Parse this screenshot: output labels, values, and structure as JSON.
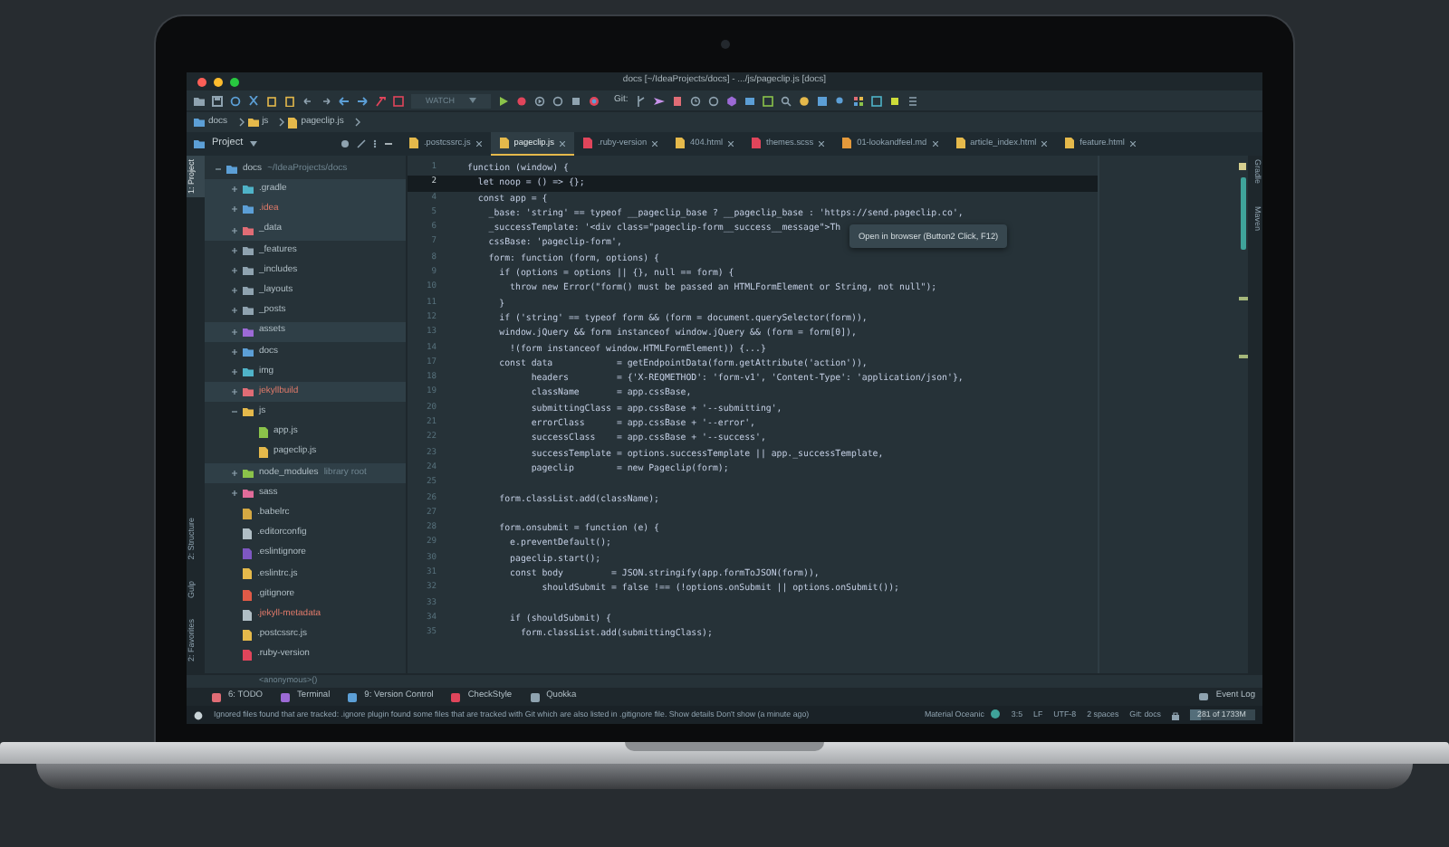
{
  "window": {
    "title": "docs [~/IdeaProjects/docs] - .../js/pageclip.js [docs]"
  },
  "toolbar": {
    "run_config": "WATCH",
    "vcs_label": "Git:"
  },
  "breadcrumb": [
    "docs",
    "js",
    "pageclip.js"
  ],
  "project_panel": {
    "title": "Project"
  },
  "tabs": [
    {
      "label": ".postcssrc.js",
      "color": "#e5b94b",
      "selected": false
    },
    {
      "label": "pageclip.js",
      "color": "#e5b94b",
      "selected": true
    },
    {
      "label": ".ruby-version",
      "color": "#e0455b",
      "selected": false
    },
    {
      "label": "404.html",
      "color": "#e5b94b",
      "selected": false
    },
    {
      "label": "themes.scss",
      "color": "#e0455b",
      "selected": false
    },
    {
      "label": "01-lookandfeel.md",
      "color": "#e59a3b",
      "selected": false
    },
    {
      "label": "article_index.html",
      "color": "#e5b94b",
      "selected": false
    },
    {
      "label": "feature.html",
      "color": "#e5b94b",
      "selected": false
    }
  ],
  "left_strip": {
    "top": [
      {
        "label": "1: Project",
        "selected": true
      }
    ],
    "bottom": [
      {
        "label": "2: Structure",
        "selected": false
      },
      {
        "label": "Gulp",
        "selected": false
      },
      {
        "label": "2: Favorites",
        "selected": false
      }
    ]
  },
  "right_strip": [
    {
      "label": "Gradle"
    },
    {
      "label": "Maven"
    }
  ],
  "tree": [
    {
      "name": "docs",
      "note": "~/IdeaProjects/docs",
      "kind": "folder",
      "color": "#5c9fd6",
      "expanded": true,
      "highlighted": false,
      "ignored": false,
      "children": [
        {
          "name": ".gradle",
          "kind": "folder",
          "color": "#4fb3c8",
          "expanded": false,
          "highlighted": true,
          "ignored": false
        },
        {
          "name": ".idea",
          "kind": "folder",
          "color": "#5c9fd6",
          "expanded": false,
          "highlighted": true,
          "ignored": true
        },
        {
          "name": "_data",
          "kind": "folder",
          "color": "#e06c75",
          "expanded": false,
          "highlighted": true,
          "ignored": false
        },
        {
          "name": "_features",
          "kind": "folder",
          "color": "#8fa3b0",
          "expanded": false,
          "highlighted": false,
          "ignored": false
        },
        {
          "name": "_includes",
          "kind": "folder",
          "color": "#8fa3b0",
          "expanded": false,
          "highlighted": false,
          "ignored": false
        },
        {
          "name": "_layouts",
          "kind": "folder",
          "color": "#8fa3b0",
          "expanded": false,
          "highlighted": false,
          "ignored": false
        },
        {
          "name": "_posts",
          "kind": "folder",
          "color": "#8fa3b0",
          "expanded": false,
          "highlighted": false,
          "ignored": false
        },
        {
          "name": "assets",
          "kind": "folder",
          "color": "#9c6ad6",
          "expanded": false,
          "highlighted": true,
          "ignored": false
        },
        {
          "name": "docs",
          "kind": "folder",
          "color": "#5c9fd6",
          "expanded": false,
          "highlighted": false,
          "ignored": false
        },
        {
          "name": "img",
          "kind": "folder",
          "color": "#4fb3c8",
          "expanded": false,
          "highlighted": false,
          "ignored": false
        },
        {
          "name": "jekyllbuild",
          "kind": "folder",
          "color": "#e06c75",
          "expanded": false,
          "highlighted": true,
          "ignored": true
        },
        {
          "name": "js",
          "kind": "folder",
          "color": "#e5b94b",
          "expanded": true,
          "highlighted": false,
          "ignored": false,
          "children": [
            {
              "name": "app.js",
              "kind": "file",
              "color": "#8bc34a",
              "highlighted": false,
              "ignored": false
            },
            {
              "name": "pageclip.js",
              "kind": "file",
              "color": "#e5b94b",
              "highlighted": false,
              "ignored": false
            }
          ]
        },
        {
          "name": "node_modules",
          "note": "library root",
          "kind": "folder",
          "color": "#8bc34a",
          "expanded": false,
          "highlighted": true,
          "ignored": false
        },
        {
          "name": "sass",
          "kind": "folder",
          "color": "#e06c9a",
          "expanded": false,
          "highlighted": false,
          "ignored": false
        },
        {
          "name": ".babelrc",
          "kind": "file",
          "color": "#d4a843",
          "highlighted": false,
          "ignored": false
        },
        {
          "name": ".editorconfig",
          "kind": "file",
          "color": "#b0bec5",
          "highlighted": false,
          "ignored": false
        },
        {
          "name": ".eslintignore",
          "kind": "file",
          "color": "#7e57c2",
          "highlighted": false,
          "ignored": false
        },
        {
          "name": ".eslintrc.js",
          "kind": "file",
          "color": "#e5b94b",
          "highlighted": false,
          "ignored": false
        },
        {
          "name": ".gitignore",
          "kind": "file",
          "color": "#e05a47",
          "highlighted": false,
          "ignored": false
        },
        {
          "name": ".jekyll-metadata",
          "kind": "file",
          "color": "#b0bec5",
          "highlighted": false,
          "ignored": true
        },
        {
          "name": ".postcssrc.js",
          "kind": "file",
          "color": "#e5b94b",
          "highlighted": false,
          "ignored": false
        },
        {
          "name": ".ruby-version",
          "kind": "file",
          "color": "#e0455b",
          "highlighted": false,
          "ignored": false
        }
      ]
    }
  ],
  "editor": {
    "lines": [
      {
        "number": "1",
        "text": "function (window) {",
        "current": false
      },
      {
        "number": "2",
        "text": "  let noop = () => {};",
        "current": true
      },
      {
        "number": "4",
        "text": "  const app = {",
        "current": false
      },
      {
        "number": "5",
        "text": "    _base: 'string' == typeof __pageclip_base ? __pageclip_base : 'https://send.pageclip.co',",
        "current": false
      },
      {
        "number": "6",
        "text": "    _successTemplate: '<div class=\"pageclip-form__success__message\">Th",
        "current": false
      },
      {
        "number": "7",
        "text": "    cssBase: 'pageclip-form',",
        "current": false
      },
      {
        "number": "8",
        "text": "    form: function (form, options) {",
        "current": false
      },
      {
        "number": "9",
        "text": "      if (options = options || {}, null == form) {",
        "current": false
      },
      {
        "number": "10",
        "text": "        throw new Error(\"form() must be passed an HTMLFormElement or String, not null\");",
        "current": false
      },
      {
        "number": "11",
        "text": "      }",
        "current": false
      },
      {
        "number": "12",
        "text": "      if ('string' == typeof form && (form = document.querySelector(form)),",
        "current": false
      },
      {
        "number": "13",
        "text": "      window.jQuery && form instanceof window.jQuery && (form = form[0]),",
        "current": false
      },
      {
        "number": "14",
        "text": "        !(form instanceof window.HTMLFormElement)) {...}",
        "current": false
      },
      {
        "number": "17",
        "text": "      const data            = getEndpointData(form.getAttribute('action')),",
        "current": false
      },
      {
        "number": "18",
        "text": "            headers         = {'X-REQMETHOD': 'form-v1', 'Content-Type': 'application/json'},",
        "current": false
      },
      {
        "number": "19",
        "text": "            className       = app.cssBase,",
        "current": false
      },
      {
        "number": "20",
        "text": "            submittingClass = app.cssBase + '--submitting',",
        "current": false
      },
      {
        "number": "21",
        "text": "            errorClass      = app.cssBase + '--error',",
        "current": false
      },
      {
        "number": "22",
        "text": "            successClass    = app.cssBase + '--success',",
        "current": false
      },
      {
        "number": "23",
        "text": "            successTemplate = options.successTemplate || app._successTemplate,",
        "current": false
      },
      {
        "number": "24",
        "text": "            pageclip        = new Pageclip(form);",
        "current": false
      },
      {
        "number": "25",
        "current": false
      },
      {
        "number": "26",
        "text": "      form.classList.add(className);",
        "current": false
      },
      {
        "number": "27",
        "current": false
      },
      {
        "number": "28",
        "text": "      form.onsubmit = function (e) {",
        "current": false
      },
      {
        "number": "29",
        "text": "        e.preventDefault();",
        "current": false
      },
      {
        "number": "30",
        "text": "        pageclip.start();",
        "current": false
      },
      {
        "number": "31",
        "text": "        const body         = JSON.stringify(app.formToJSON(form)),",
        "current": false
      },
      {
        "number": "32",
        "text": "              shouldSubmit = false !== (!options.onSubmit || options.onSubmit());",
        "current": false
      },
      {
        "number": "33",
        "current": false
      },
      {
        "number": "34",
        "text": "        if (shouldSubmit) {",
        "current": false
      },
      {
        "number": "35",
        "text": "          form.classList.add(submittingClass);",
        "current": false
      }
    ],
    "tooltip": "Open in browser (Button2 Click, F12)",
    "breadcrumb": "<anonymous>()"
  },
  "tool_windows": [
    {
      "label": "6: TODO",
      "color": "#e06c75"
    },
    {
      "label": "Terminal",
      "color": "#9c6ad6"
    },
    {
      "label": "9: Version Control",
      "color": "#5c9fd6"
    },
    {
      "label": "CheckStyle",
      "color": "#e0455b"
    },
    {
      "label": "Quokka",
      "color": "#8fa3b0"
    }
  ],
  "event_log": "Event Log",
  "status_bar": {
    "message": "Ignored files found that are tracked: .ignore plugin found some files that are tracked with Git which are also listed in .gitignore file. Show details Don't show (a minute ago)",
    "theme": "Material Oceanic",
    "position": "3:5",
    "line_separator": "LF",
    "encoding": "UTF-8",
    "indent": "2 spaces",
    "branch": "Git: docs",
    "memory": "281 of 1733M",
    "memory_level": {
      "level": 0.16
    }
  }
}
